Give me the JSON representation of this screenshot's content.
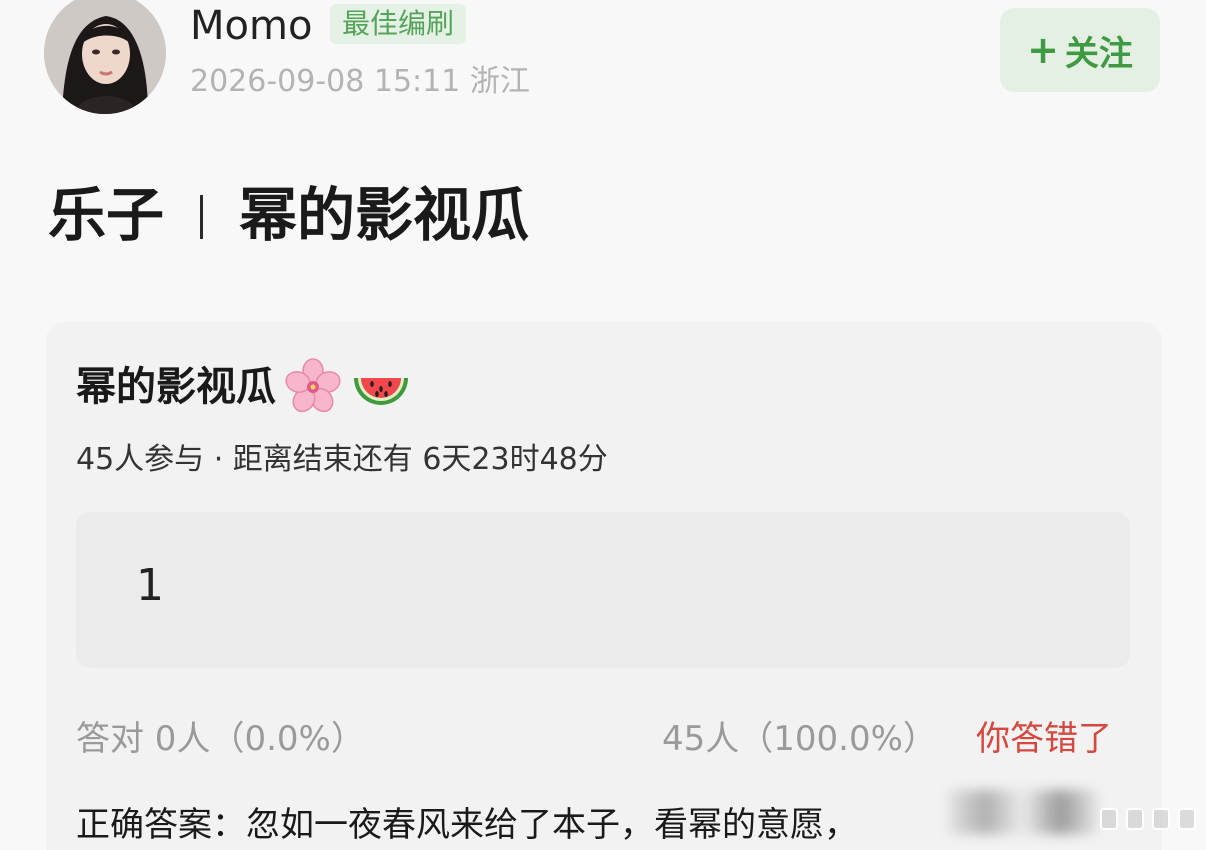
{
  "post": {
    "username": "Momo",
    "badge": "最佳编刷",
    "meta": "2026-09-08 15:11  浙江",
    "follow_label": "关注",
    "title_left": "乐子",
    "title_right": "幂的影视瓜"
  },
  "poll": {
    "title": "幂的影视瓜",
    "title_emojis": [
      "cherry-blossom-icon",
      "watermelon-icon"
    ],
    "meta": "45人参与 · 距离结束还有 6天23时48分",
    "option_text": "1",
    "stats_left": "答对  0人（0.0%）",
    "stats_right": "45人（100.0%）",
    "result": "你答错了",
    "answer": "正确答案：忽如一夜春风来给了本子，看幂的意愿，"
  },
  "colors": {
    "accent_green": "#3f9a43",
    "badge_green": "#56a35a",
    "wrong_red": "#d4483f"
  }
}
